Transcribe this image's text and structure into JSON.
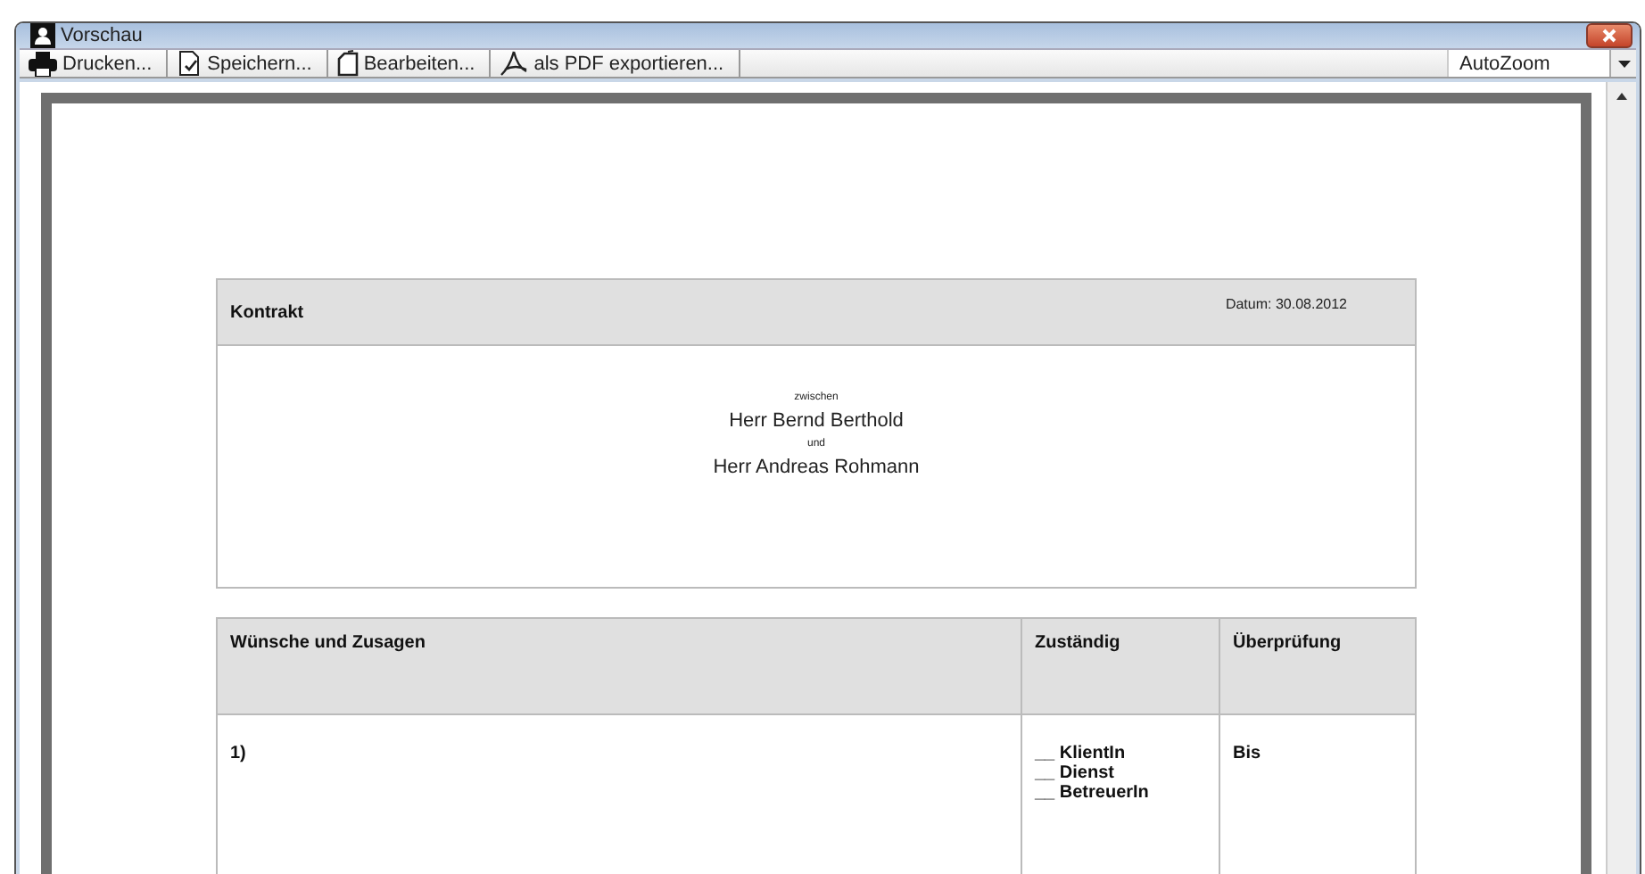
{
  "window": {
    "title": "Vorschau"
  },
  "toolbar": {
    "buttons": [
      {
        "kind": "print",
        "label": "Drucken..."
      },
      {
        "kind": "save",
        "label": "Speichern..."
      },
      {
        "kind": "edit",
        "label": "Bearbeiten..."
      },
      {
        "kind": "pdf",
        "label": "als PDF exportieren..."
      }
    ],
    "zoom": {
      "value": "AutoZoom"
    }
  },
  "document": {
    "header": {
      "title": "Kontrakt",
      "date": "Datum: 30.08.2012",
      "lines": [
        {
          "kind": "small",
          "text": "zwischen"
        },
        {
          "kind": "name",
          "text": "Herr Bernd Berthold"
        },
        {
          "kind": "small",
          "text": "und"
        },
        {
          "kind": "name",
          "text": "Herr Andreas Rohmann"
        }
      ]
    },
    "table": {
      "columns": [
        "Wünsche und Zusagen",
        "Zuständig",
        "Überprüfung"
      ],
      "rows": [
        {
          "number": "1)",
          "responsible": [
            "__ KlientIn",
            "__ Dienst",
            "__ BetreuerIn"
          ],
          "review": "Bis"
        }
      ]
    }
  }
}
